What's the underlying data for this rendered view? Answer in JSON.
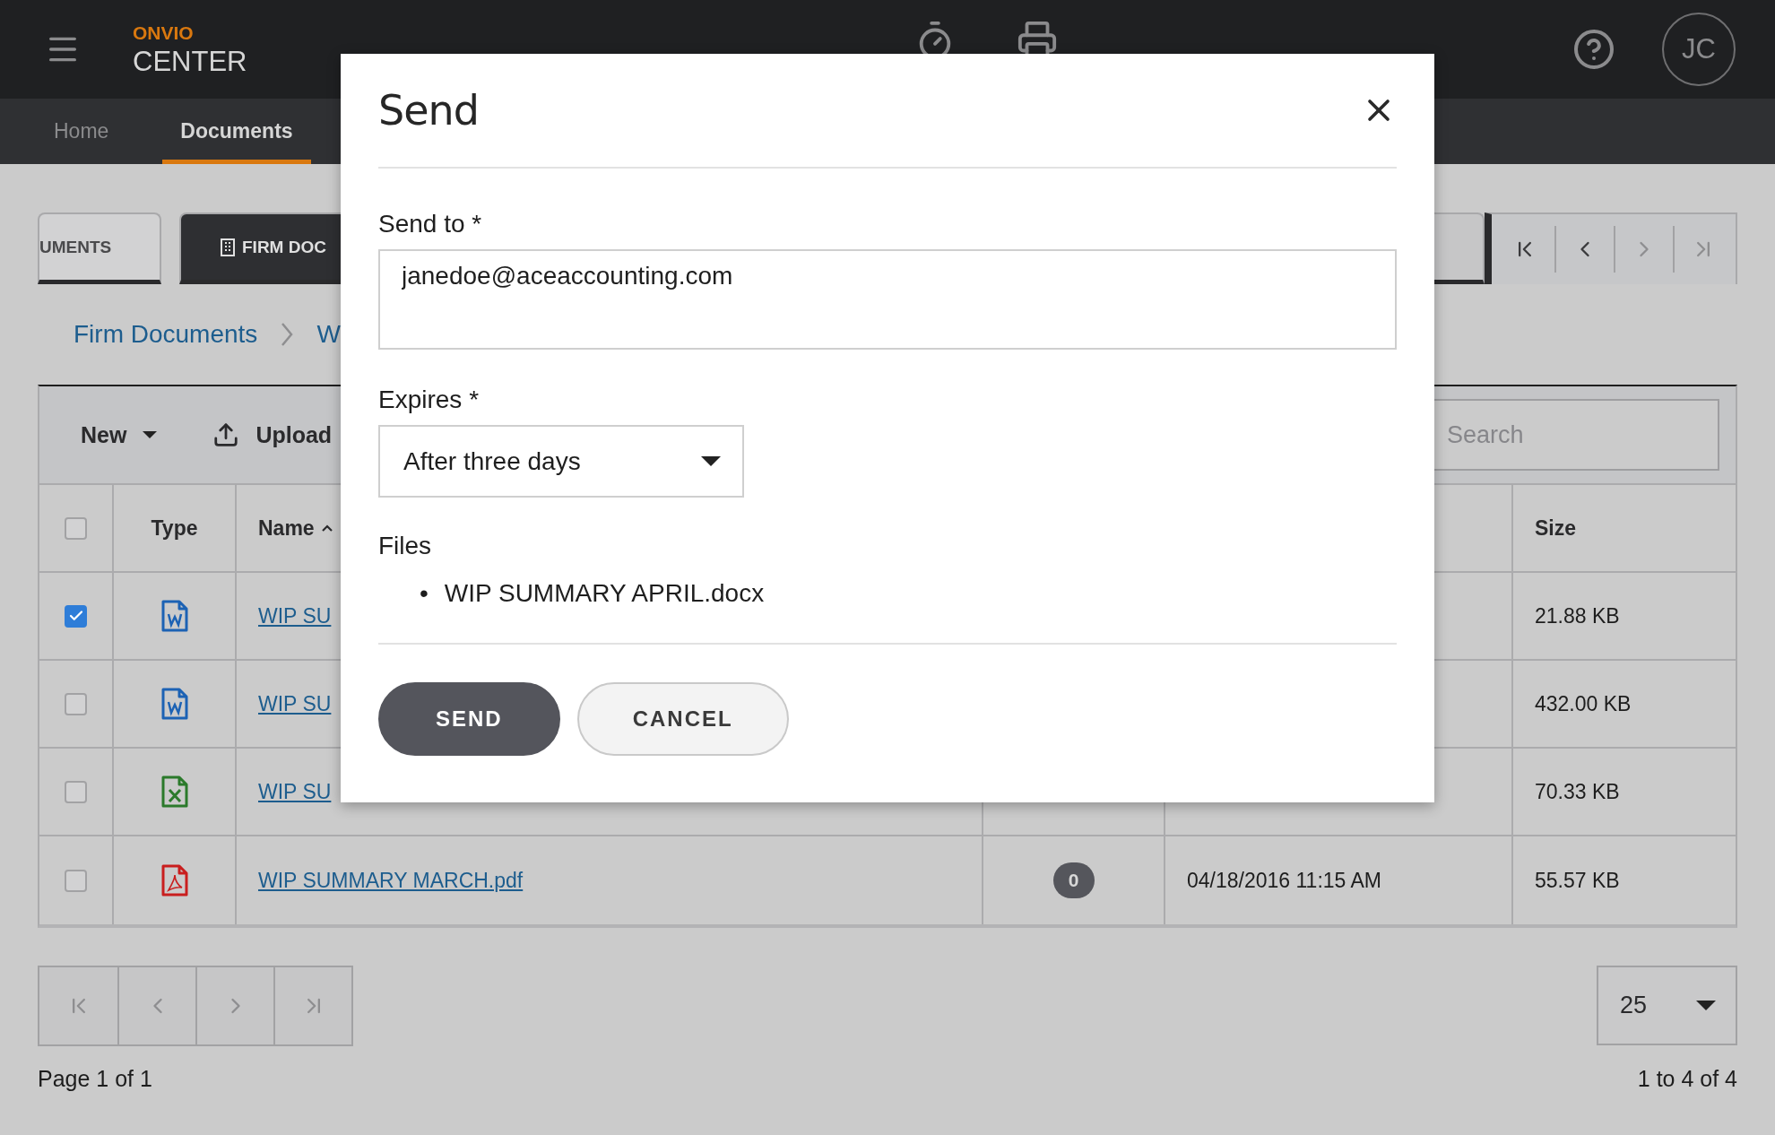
{
  "header": {
    "brand_top": "ONVIO",
    "brand_bottom": "CENTER",
    "avatar": "JC"
  },
  "nav": [
    {
      "label": "Home",
      "selected": false
    },
    {
      "label": "Documents",
      "selected": true
    }
  ],
  "doc_tabs": [
    {
      "label": "UMENTS",
      "selected": false
    },
    {
      "label": "FIRM DOC",
      "selected": true
    }
  ],
  "breadcrumb": [
    "Firm Documents",
    "W"
  ],
  "toolbar": {
    "new": "New",
    "upload": "Upload",
    "search_placeholder": "Search"
  },
  "table": {
    "select_all": {
      "checked": false
    },
    "columns": [
      "Type",
      "Name",
      "Size"
    ],
    "rows": [
      {
        "checked": true,
        "kind": "word",
        "name": "WIP SU",
        "size": "21.88 KB"
      },
      {
        "checked": false,
        "kind": "word",
        "name": "WIP SU",
        "size": "432.00 KB"
      },
      {
        "checked": false,
        "kind": "excel",
        "name": "WIP SU",
        "size": "70.33 KB"
      },
      {
        "checked": false,
        "kind": "pdf",
        "name": "WIP SUMMARY MARCH.pdf",
        "badge": "0",
        "modified": "04/18/2016 11:15 AM",
        "size": "55.57 KB"
      }
    ]
  },
  "pager": {
    "page_size": "25",
    "page_text": "Page 1 of 1",
    "range_text": "1 to 4 of 4"
  },
  "dialog": {
    "title": "Send",
    "send_to": {
      "label": "Send to",
      "required_mark": "*",
      "value": "janedoe@aceaccounting.com"
    },
    "expires": {
      "label": "Expires",
      "required_mark": "*",
      "value": "After three days"
    },
    "files_label": "Files",
    "files": [
      {
        "marker": "•",
        "name": "WIP SUMMARY APRIL.docx"
      }
    ],
    "buttons": [
      {
        "label": "SEND",
        "kind": "primary"
      },
      {
        "label": "CANCEL",
        "kind": "secondary"
      }
    ]
  }
}
